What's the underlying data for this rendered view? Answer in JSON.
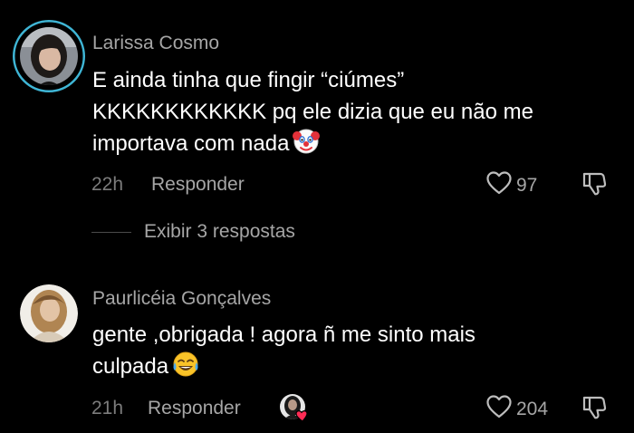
{
  "comments": [
    {
      "author": "Larissa Cosmo",
      "lines": [
        "E ainda tinha que fingir “ciúmes”",
        "KKKKKKKKKKKK pq ele dizia que eu não me",
        "importava com nada"
      ],
      "emoji": "clown-face-emoji",
      "time": "22h",
      "reply_label": "Responder",
      "likes": "97",
      "view_replies": "Exibir 3 respostas"
    },
    {
      "author": "Paurlicéia Gonçalves",
      "lines": [
        "gente ,obrigada ! agora ñ me sinto mais",
        "culpada"
      ],
      "emoji": "tears-of-joy-emoji",
      "time": "21h",
      "reply_label": "Responder",
      "likes": "204"
    }
  ],
  "icons": {
    "like": "heart-outline-icon",
    "dislike": "thumbs-down-icon",
    "creator_liked": "creator-liked-badge"
  },
  "colors": {
    "background": "#000000",
    "author": "#a6a6a6",
    "body": "#ffffff",
    "muted": "#7c7c7c",
    "avatar_ring": "#3fb6d6",
    "creator_heart": "#fe2c55"
  }
}
